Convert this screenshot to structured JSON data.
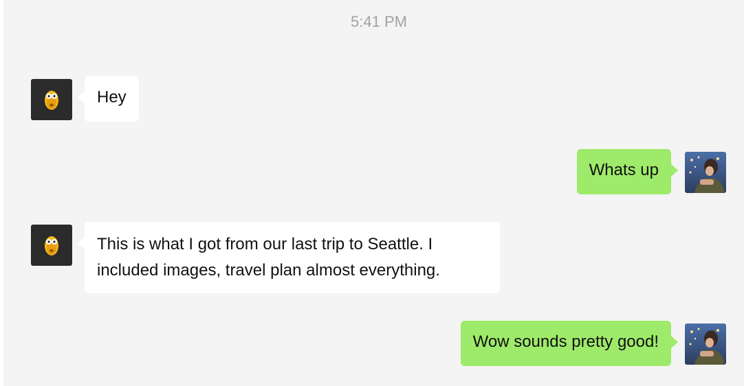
{
  "chat": {
    "timestamp": "5:41 PM",
    "messages": [
      {
        "sender": "contact",
        "text": "Hey"
      },
      {
        "sender": "me",
        "text": "Whats up"
      },
      {
        "sender": "contact",
        "text": "This is what I got from our last trip to Seattle. I included images, travel plan almost everything."
      },
      {
        "sender": "me",
        "text": "Wow sounds pretty good!"
      }
    ]
  },
  "colors": {
    "background": "#f4f4f4",
    "incoming_bubble": "#ffffff",
    "outgoing_bubble": "#9eea6a",
    "timestamp_text": "#a2a2a2",
    "contact_avatar_bg": "#2b2b2b"
  },
  "icons": {
    "contact_avatar": "cartoon-yellow-face-icon",
    "user_avatar": "photo-avatar-icon"
  }
}
